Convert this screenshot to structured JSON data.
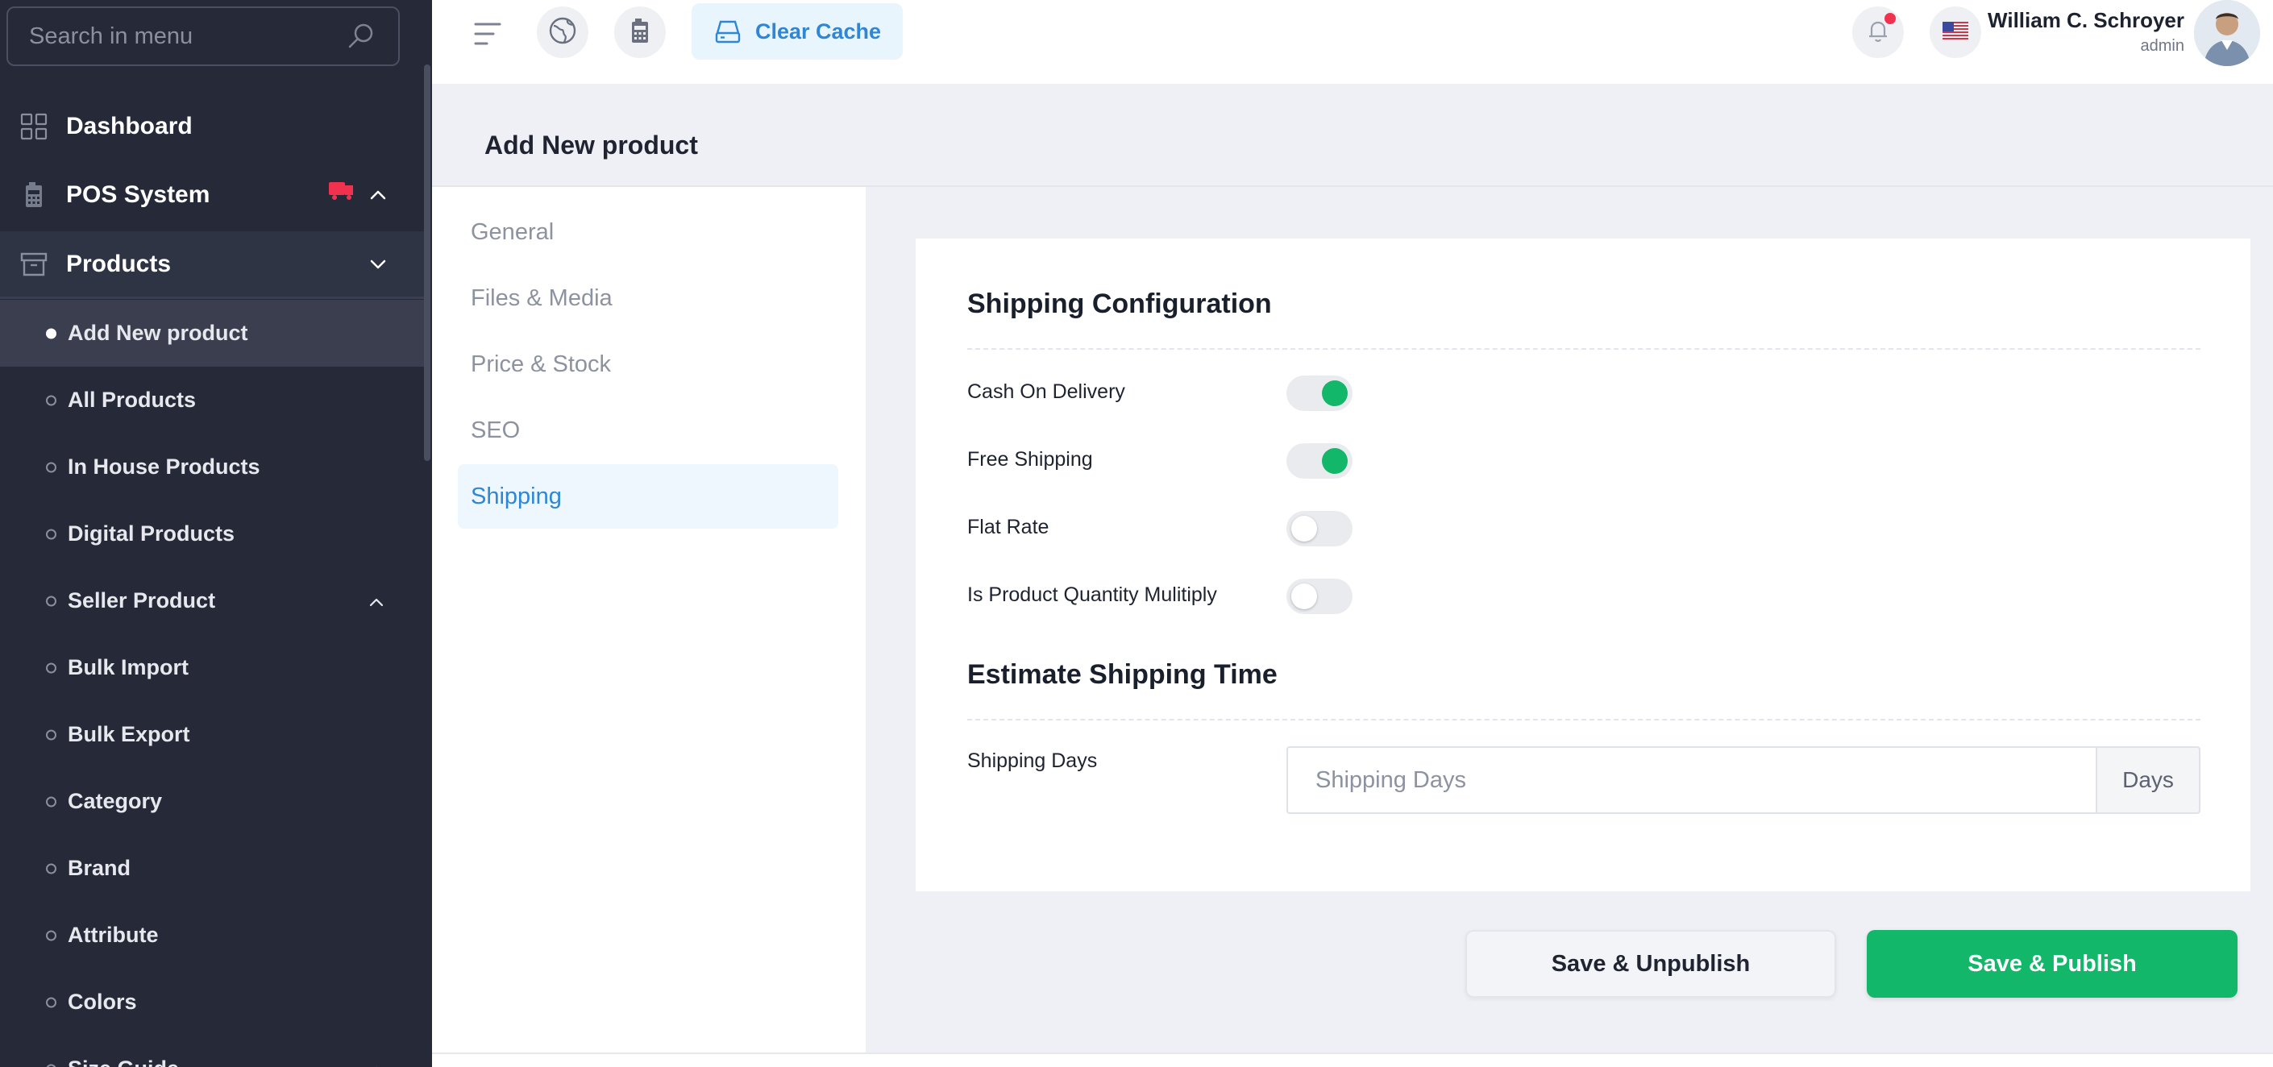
{
  "sidebar": {
    "search_placeholder": "Search in menu",
    "items": [
      {
        "label": "Dashboard",
        "icon": "grid-icon"
      },
      {
        "label": "POS System",
        "icon": "calculator-icon",
        "badge_icon": "pos-badge-icon",
        "badge_color": "#f0324f"
      },
      {
        "label": "Products",
        "icon": "archive-box-icon"
      }
    ],
    "product_sub_items": [
      {
        "label": "Add New product",
        "active": true
      },
      {
        "label": "All Products"
      },
      {
        "label": "In House Products"
      },
      {
        "label": "Digital Products"
      },
      {
        "label": "Seller Product",
        "has_chevron": true
      },
      {
        "label": "Bulk Import"
      },
      {
        "label": "Bulk Export"
      },
      {
        "label": "Category"
      },
      {
        "label": "Brand"
      },
      {
        "label": "Attribute"
      },
      {
        "label": "Colors"
      },
      {
        "label": "Size Guide",
        "has_chevron": true
      }
    ]
  },
  "topbar": {
    "clear_cache_label": "Clear Cache",
    "user_name": "William C. Schroyer",
    "user_role": "admin",
    "accent": "#2f86d4"
  },
  "page": {
    "title": "Add New product"
  },
  "tabs": [
    {
      "label": "General"
    },
    {
      "label": "Files & Media"
    },
    {
      "label": "Price & Stock"
    },
    {
      "label": "SEO"
    },
    {
      "label": "Shipping",
      "active": true
    }
  ],
  "shipping": {
    "config_title": "Shipping Configuration",
    "options": [
      {
        "label": "Cash On Delivery",
        "enabled": true
      },
      {
        "label": "Free Shipping",
        "enabled": true
      },
      {
        "label": "Flat Rate",
        "enabled": false
      },
      {
        "label": "Is Product Quantity Mulitiply",
        "enabled": false
      }
    ],
    "estimate_title": "Estimate Shipping Time",
    "days_label": "Shipping Days",
    "days_placeholder": "Shipping Days",
    "days_suffix": "Days",
    "toggle_on_color": "#12b76a"
  },
  "actions": {
    "unpublish_label": "Save & Unpublish",
    "publish_label": "Save & Publish",
    "publish_color": "#12b76a"
  }
}
